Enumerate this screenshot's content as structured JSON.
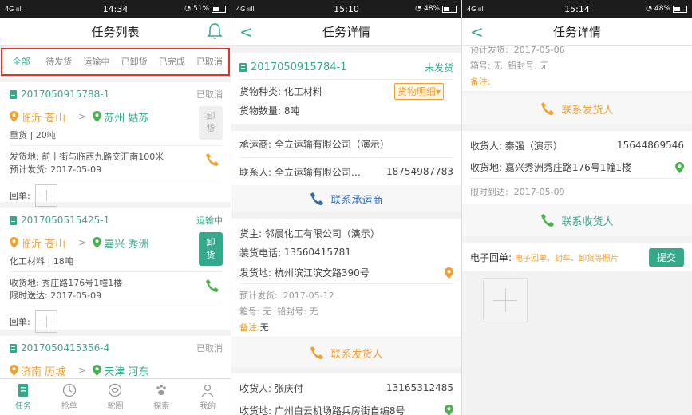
{
  "status_bars": [
    {
      "signal": "4G ııll",
      "time": "14:34",
      "battery": "51%"
    },
    {
      "signal": "4G ııll",
      "time": "15:10",
      "battery": "48%"
    },
    {
      "signal": "4G ııll",
      "time": "15:14",
      "battery": "48%"
    }
  ],
  "list": {
    "title": "任务列表",
    "tabs": [
      "全部",
      "待发货",
      "运输中",
      "已卸货",
      "已完成",
      "已取消"
    ],
    "active_tab": 0,
    "cards": [
      {
        "no": "2017050915788-1",
        "status": "已取消",
        "from": "临沂 苍山",
        "to": "苏州 姑苏",
        "goods": "重货 | 20吨",
        "unload": "卸货",
        "addr_label": "发货地:",
        "addr": "前十街与临西九路交汇南100米",
        "time_label": "预计发货:",
        "time": "2017-05-09",
        "receipt": "回单:"
      },
      {
        "no": "2017050515425-1",
        "status": "运输中",
        "from": "临沂 苍山",
        "to": "嘉兴 秀洲",
        "goods": "化工材料 | 18吨",
        "unload": "卸货",
        "addr_label": "收货地:",
        "addr": "秀庄路176号1幢1楼",
        "time_label": "限时送达:",
        "time": "2017-05-09",
        "receipt": "回单:"
      },
      {
        "no": "2017050415356-4",
        "status": "已取消",
        "from": "济南 历城",
        "to": "天津 河东"
      }
    ],
    "nav": [
      "任务",
      "抢单",
      "驼圈",
      "探索",
      "我的"
    ]
  },
  "detail1": {
    "title": "任务详情",
    "order_no": "2017050915784-1",
    "order_status": "未发货",
    "goods_type_label": "货物种类:",
    "goods_type": "化工材料",
    "goods_btn": "货物明细",
    "goods_qty_label": "货物数量:",
    "goods_qty": "8吨",
    "carrier_label": "承运商:",
    "carrier": "全立运输有限公司（演示）",
    "contact_label": "联系人:",
    "contact": "全立运输有限公司…",
    "contact_phone": "18754987783",
    "contact_carrier": "联系承运商",
    "shipper_label": "货主:",
    "shipper": "邻晨化工有限公司（演示）",
    "load_phone_label": "装货电话:",
    "load_phone": "13560415781",
    "ship_addr_label": "发货地:",
    "ship_addr": "杭州滨江滨文路390号",
    "est_ship_label": "预计发货:",
    "est_ship": "2017-05-12",
    "box_label": "箱号: 无",
    "seal_label": "铅封号: 无",
    "note_label": "备注:",
    "note": "无",
    "contact_shipper": "联系发货人",
    "receiver_label": "收货人:",
    "receiver": "张庆付",
    "receiver_phone": "13165312485",
    "recv_addr_label": "收货地:",
    "recv_addr": "广州白云机场路兵房街自编8号"
  },
  "detail2": {
    "title": "任务详情",
    "est_ship_label": "预计发货:",
    "est_ship": "2017-05-06",
    "box_label": "箱号: 无",
    "seal_label": "铅封号: 无",
    "note_label": "备注:",
    "contact_shipper": "联系发货人",
    "receiver_label": "收货人:",
    "receiver": "秦强（演示）",
    "receiver_phone": "15644869546",
    "recv_addr_label": "收货地:",
    "recv_addr": "嘉兴秀洲秀庄路176号1幢1楼",
    "deadline_label": "限时到达:",
    "deadline": "2017-05-09",
    "contact_receiver": "联系收货人",
    "ereceipt_label": "电子回单:",
    "ereceipt_hint": "电子回单、封车、卸货等照片",
    "submit": "提交"
  }
}
